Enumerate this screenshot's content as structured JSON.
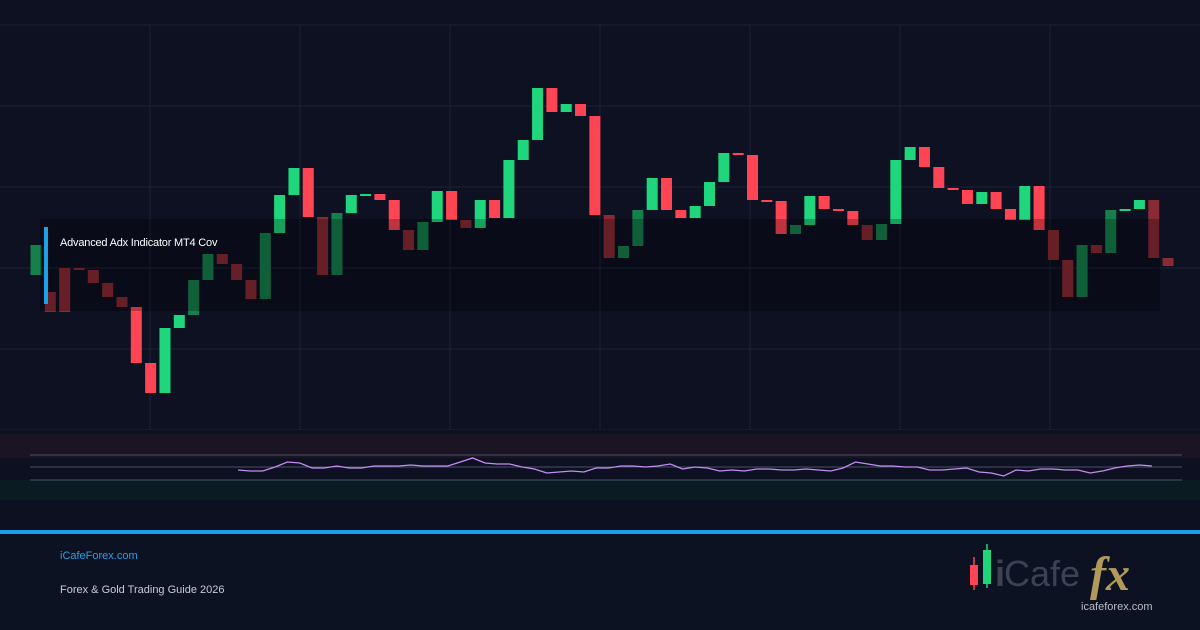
{
  "chart_data": {
    "type": "candlestick",
    "title": "Advanced Adx Indicator MT4 Cov",
    "grid": true,
    "colors": {
      "up": "#1fd67c",
      "down": "#ff4553",
      "oscillator": "#c48cf0",
      "accent": "#1ea0e6"
    },
    "candles": [
      [
        275,
        245,
        305,
        210
      ],
      [
        292,
        312,
        313,
        272
      ],
      [
        268,
        312,
        314,
        258
      ],
      [
        268,
        270,
        275,
        265
      ],
      [
        270,
        283,
        286,
        266
      ],
      [
        283,
        297,
        300,
        279
      ],
      [
        297,
        307,
        312,
        293
      ],
      [
        307,
        363,
        364,
        300
      ],
      [
        363,
        393,
        396,
        352
      ],
      [
        393,
        328,
        401,
        325
      ],
      [
        328,
        315,
        326,
        312
      ],
      [
        315,
        280,
        316,
        280
      ],
      [
        280,
        254,
        282,
        250
      ],
      [
        254,
        264,
        266,
        251
      ],
      [
        264,
        280,
        281,
        254
      ],
      [
        280,
        299,
        306,
        266
      ],
      [
        299,
        233,
        380,
        230
      ],
      [
        233,
        195,
        238,
        180
      ],
      [
        195,
        168,
        218,
        170
      ],
      [
        168,
        217,
        218,
        128
      ],
      [
        217,
        275,
        350,
        210
      ],
      [
        275,
        213,
        333,
        190
      ],
      [
        213,
        195,
        215,
        181
      ],
      [
        195,
        194,
        203,
        190
      ],
      [
        194,
        200,
        204,
        196
      ],
      [
        200,
        230,
        230,
        184
      ],
      [
        230,
        250,
        252,
        224
      ],
      [
        250,
        222,
        258,
        221
      ],
      [
        222,
        191,
        227,
        178
      ],
      [
        191,
        220,
        222,
        182
      ],
      [
        220,
        228,
        228,
        206
      ],
      [
        228,
        200,
        229,
        192
      ],
      [
        200,
        218,
        226,
        197
      ],
      [
        218,
        160,
        224,
        146
      ],
      [
        160,
        140,
        155,
        125
      ],
      [
        140,
        88,
        145,
        65
      ],
      [
        88,
        112,
        125,
        53
      ],
      [
        112,
        104,
        115,
        101
      ],
      [
        104,
        116,
        122,
        94
      ],
      [
        116,
        215,
        220,
        110
      ],
      [
        215,
        258,
        262,
        212
      ],
      [
        258,
        246,
        260,
        220
      ],
      [
        246,
        210,
        250,
        208
      ],
      [
        210,
        178,
        212,
        153
      ],
      [
        178,
        210,
        216,
        150
      ],
      [
        210,
        218,
        218,
        204
      ],
      [
        218,
        206,
        230,
        212
      ],
      [
        206,
        182,
        228,
        172
      ],
      [
        182,
        153,
        183,
        145
      ],
      [
        153,
        155,
        160,
        150
      ],
      [
        155,
        200,
        202,
        127
      ],
      [
        200,
        201,
        203,
        195
      ],
      [
        201,
        234,
        235,
        196
      ],
      [
        234,
        225,
        236,
        211
      ],
      [
        225,
        196,
        228,
        174
      ],
      [
        196,
        209,
        212,
        189
      ],
      [
        209,
        211,
        213,
        205
      ],
      [
        211,
        225,
        228,
        206
      ],
      [
        225,
        240,
        245,
        217
      ],
      [
        240,
        224,
        244,
        212
      ],
      [
        224,
        160,
        194,
        95
      ],
      [
        160,
        147,
        162,
        125
      ],
      [
        147,
        167,
        170,
        130
      ],
      [
        167,
        188,
        191,
        162
      ],
      [
        188,
        190,
        194,
        184
      ],
      [
        190,
        204,
        206,
        181
      ],
      [
        204,
        192,
        208,
        187
      ],
      [
        192,
        209,
        216,
        189
      ],
      [
        209,
        220,
        223,
        193
      ],
      [
        220,
        186,
        224,
        184
      ],
      [
        186,
        230,
        232,
        158
      ],
      [
        230,
        260,
        288,
        218
      ],
      [
        260,
        297,
        306,
        250
      ],
      [
        297,
        245,
        326,
        235
      ],
      [
        245,
        253,
        256,
        244
      ],
      [
        253,
        210,
        256,
        203
      ],
      [
        210,
        209,
        213,
        204
      ],
      [
        209,
        200,
        208,
        196
      ],
      [
        200,
        258,
        259,
        170
      ],
      [
        258,
        266,
        270,
        243
      ]
    ],
    "oscillator": [
      470,
      471,
      471,
      467,
      462,
      463,
      468,
      468,
      466,
      468,
      468,
      466,
      466,
      466,
      465,
      466,
      466,
      466,
      462,
      458,
      463,
      464,
      464,
      467,
      469,
      473,
      472,
      471,
      472,
      468,
      468,
      466,
      466,
      467,
      466,
      464,
      469,
      467,
      468,
      471,
      470,
      471,
      469,
      469,
      470,
      470,
      469,
      470,
      471,
      468,
      462,
      464,
      466,
      466,
      467,
      467,
      470,
      470,
      469,
      468,
      472,
      473,
      476,
      470,
      471,
      469,
      469,
      470,
      470,
      473,
      471,
      468,
      466,
      465,
      466
    ]
  },
  "footer": {
    "site_url": "iCafeForex.com",
    "guide_title": "Forex & Gold Trading Guide 2026",
    "logo_i": "i",
    "logo_cafe": "Cafe",
    "logo_fx": "fx",
    "logo_domain": "icafeforex.com"
  }
}
